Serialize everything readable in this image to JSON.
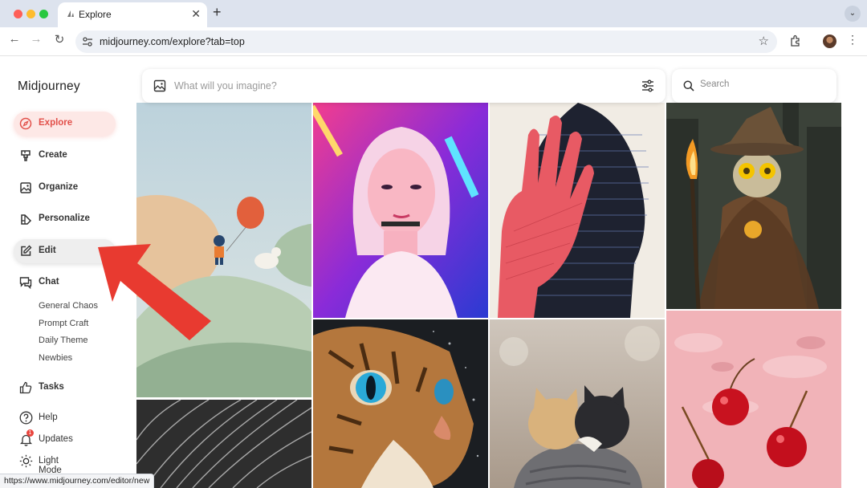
{
  "browser": {
    "tab_title": "Explore",
    "url": "midjourney.com/explore?tab=top",
    "status_url": "https://www.midjourney.com/editor/new"
  },
  "sidebar": {
    "brand": "Midjourney",
    "items": [
      {
        "label": "Explore",
        "icon": "compass-icon",
        "state": "active"
      },
      {
        "label": "Create",
        "icon": "brush-icon"
      },
      {
        "label": "Organize",
        "icon": "image-icon"
      },
      {
        "label": "Personalize",
        "icon": "palette-icon"
      },
      {
        "label": "Edit",
        "icon": "edit-icon",
        "state": "hover"
      },
      {
        "label": "Chat",
        "icon": "chat-icon"
      }
    ],
    "chat_channels": [
      "General Chaos",
      "Prompt Craft",
      "Daily Theme",
      "Newbies"
    ],
    "tasks_label": "Tasks",
    "footer": {
      "help": "Help",
      "updates": "Updates",
      "updates_badge": "1",
      "light_mode": "Light Mode"
    }
  },
  "prompt": {
    "placeholder": "What will you imagine?"
  },
  "search": {
    "placeholder": "Search"
  },
  "colors": {
    "accent": "#e2504a",
    "annotation_arrow": "#e83a30"
  },
  "gallery": {
    "images": [
      "pastel-hills-child-balloon",
      "neon-portrait-woman",
      "line-art-face-red-hand",
      "skeleton-wizard-torch",
      "cat-blue-eyes-closeup",
      "two-kittens-hugging",
      "cherries-in-pink-water",
      "gray-feathers"
    ]
  }
}
